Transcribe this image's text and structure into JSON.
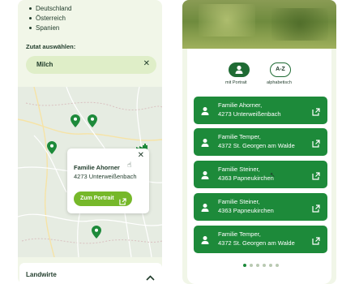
{
  "left": {
    "countries": [
      "Deutschland",
      "Österreich",
      "Spanien"
    ],
    "zutat_label": "Zutat auswählen:",
    "zutat_value": "Milch",
    "popup": {
      "name": "Familie Ahorner",
      "address": "4273 Unterweißenbach",
      "button_label": "Zum Portrait"
    },
    "accordion_label": "Landwirte"
  },
  "right": {
    "toggles": [
      {
        "label": "mit Portrait",
        "active": true
      },
      {
        "label": "alphabetisch",
        "active": false,
        "icon_text": "A-Z"
      }
    ],
    "farms": [
      {
        "name": "Familie Ahorner,",
        "place": "4273 Unterweißenbach"
      },
      {
        "name": "Familie Temper,",
        "place": "4372 St. Georgen am Walde"
      },
      {
        "name": "Familie Steiner,",
        "place": "4363 Papneukirchen"
      },
      {
        "name": "Familie Steiner,",
        "place": "4363 Papneukirchen"
      },
      {
        "name": "Familie Temper,",
        "place": "4372 St. Georgen am Walde"
      }
    ],
    "pager": {
      "total": 6,
      "current": 1
    }
  },
  "colors": {
    "dark_green": "#1f3b2a",
    "button_green": "#1d8a3a",
    "accent_green": "#76b82a",
    "light_green": "#dfeec8",
    "panel_bg": "#f1f6e8"
  },
  "icons": {
    "close": "close-icon",
    "external": "external-link-icon",
    "person": "person-icon",
    "chevron": "chevron-up-icon",
    "pin": "map-pin-icon",
    "factory": "factory-icon"
  }
}
